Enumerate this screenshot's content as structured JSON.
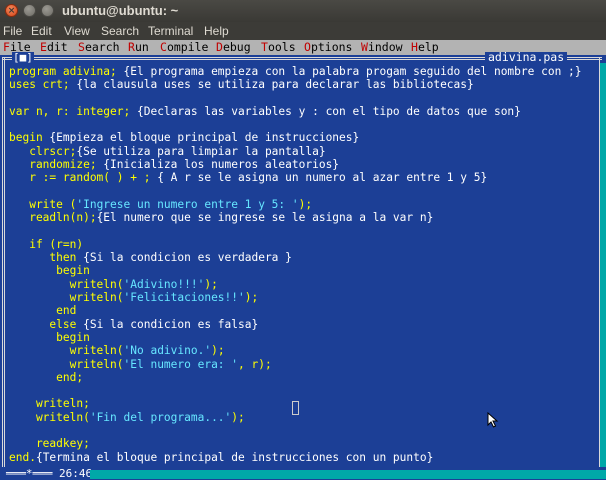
{
  "window": {
    "title": "ubuntu@ubuntu: ~"
  },
  "terminal_menu": [
    "File",
    "Edit",
    "View",
    "Search",
    "Terminal",
    "Help"
  ],
  "ide_menu": [
    {
      "hot": "F",
      "rest": "ile"
    },
    {
      "hot": "E",
      "rest": "dit"
    },
    {
      "hot": "S",
      "rest": "earch"
    },
    {
      "hot": "R",
      "rest": "un"
    },
    {
      "hot": "C",
      "rest": "ompile"
    },
    {
      "hot": "D",
      "rest": "ebug"
    },
    {
      "hot": "T",
      "rest": "ools"
    },
    {
      "hot": "O",
      "rest": "ptions"
    },
    {
      "hot": "W",
      "rest": "indow"
    },
    {
      "hot": "H",
      "rest": "elp"
    }
  ],
  "editor": {
    "close_marker": "[■]",
    "filename": "adivina.pas",
    "status": "═══*═══ 26:46"
  },
  "code_lines": [
    [
      {
        "t": "program adivina; ",
        "k": "kw"
      },
      {
        "t": "{El programa empieza con la palabra progam seguido del nombre con ;}",
        "k": "c"
      }
    ],
    [
      {
        "t": "uses crt; ",
        "k": "kw"
      },
      {
        "t": "{la clausula uses se utiliza para declarar las bibliotecas}",
        "k": "c"
      }
    ],
    [],
    [
      {
        "t": "var n, r: integer; ",
        "k": "kw"
      },
      {
        "t": "{Declaras las variables y : con el tipo de datos que son}",
        "k": "c"
      }
    ],
    [],
    [
      {
        "t": "begin ",
        "k": "kw"
      },
      {
        "t": "{Empieza el bloque principal de instrucciones}",
        "k": "c"
      }
    ],
    [
      {
        "t": "   clrscr;",
        "k": "kw"
      },
      {
        "t": "{Se utiliza para limpiar la pantalla}",
        "k": "c"
      }
    ],
    [
      {
        "t": "   randomize; ",
        "k": "kw"
      },
      {
        "t": "{Inicializa los numeros aleatorios}",
        "k": "c"
      }
    ],
    [
      {
        "t": "   r := random( ) + ; ",
        "k": "kw"
      },
      {
        "t": "{ A r se le asigna un numero al azar entre 1 y 5}",
        "k": "c"
      }
    ],
    [],
    [
      {
        "t": "   write (",
        "k": "kw"
      },
      {
        "t": "'Ingrese un numero entre 1 y 5: '",
        "k": "s"
      },
      {
        "t": ");",
        "k": "kw"
      }
    ],
    [
      {
        "t": "   readln(n);",
        "k": "kw"
      },
      {
        "t": "{El numero que se ingrese se le asigna a la var n}",
        "k": "c"
      }
    ],
    [],
    [
      {
        "t": "   if (r=n)",
        "k": "kw"
      }
    ],
    [
      {
        "t": "      then ",
        "k": "kw"
      },
      {
        "t": "{Si la condicion es verdadera }",
        "k": "c"
      }
    ],
    [
      {
        "t": "       begin",
        "k": "kw"
      }
    ],
    [
      {
        "t": "         writeln(",
        "k": "kw"
      },
      {
        "t": "'Adivino!!!'",
        "k": "s"
      },
      {
        "t": ");",
        "k": "kw"
      }
    ],
    [
      {
        "t": "         writeln(",
        "k": "kw"
      },
      {
        "t": "'Felicitaciones!!'",
        "k": "s"
      },
      {
        "t": ");",
        "k": "kw"
      }
    ],
    [
      {
        "t": "       end",
        "k": "kw"
      }
    ],
    [
      {
        "t": "      else ",
        "k": "kw"
      },
      {
        "t": "{Si la condicion es falsa}",
        "k": "c"
      }
    ],
    [
      {
        "t": "       begin",
        "k": "kw"
      }
    ],
    [
      {
        "t": "         writeln(",
        "k": "kw"
      },
      {
        "t": "'No adivino.'",
        "k": "s"
      },
      {
        "t": ");",
        "k": "kw"
      }
    ],
    [
      {
        "t": "         writeln(",
        "k": "kw"
      },
      {
        "t": "'El numero era: '",
        "k": "s"
      },
      {
        "t": ", r);",
        "k": "kw"
      }
    ],
    [
      {
        "t": "       end;",
        "k": "kw"
      }
    ],
    [],
    [
      {
        "t": "    writeln;",
        "k": "kw"
      }
    ],
    [
      {
        "t": "    writeln(",
        "k": "kw"
      },
      {
        "t": "'Fin del programa...'",
        "k": "s"
      },
      {
        "t": ");",
        "k": "kw"
      }
    ],
    [],
    [
      {
        "t": "    readkey;",
        "k": "kw"
      }
    ],
    [
      {
        "t": "end.",
        "k": "kw"
      },
      {
        "t": "{Termina el bloque principal de instrucciones con un punto}",
        "k": "c"
      }
    ]
  ],
  "colors": {
    "editor_bg": "#1c3f96",
    "keyword": "#ffff00",
    "comment": "#ffffff",
    "string": "#66e6ff",
    "accent": "#00a8a8"
  }
}
